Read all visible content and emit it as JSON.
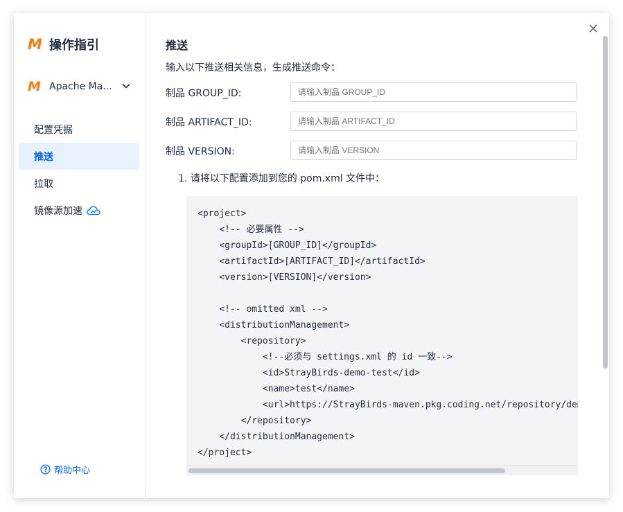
{
  "sidebar": {
    "logo_letter": "M",
    "title": "操作指引",
    "repo": {
      "name": "Apache Ma...",
      "icon": "maven-logo-icon",
      "dropdown_icon": "chevron-down-icon"
    },
    "nav": [
      {
        "label": "配置凭据",
        "active": false
      },
      {
        "label": "推送",
        "active": true
      },
      {
        "label": "拉取",
        "active": false
      },
      {
        "label": "镜像源加速",
        "active": false,
        "icon": "cloud-icon"
      }
    ],
    "help": {
      "label": "帮助中心",
      "icon": "question-circle-icon"
    }
  },
  "main": {
    "title": "推送",
    "description": "输入以下推送相关信息，生成推送命令：",
    "fields": [
      {
        "label": "制品 GROUP_ID:",
        "placeholder": "请输入制品 GROUP_ID",
        "value": ""
      },
      {
        "label": "制品 ARTIFACT_ID:",
        "placeholder": "请输入制品 ARTIFACT_ID",
        "value": ""
      },
      {
        "label": "制品 VERSION:",
        "placeholder": "请输入制品 VERSION",
        "value": ""
      }
    ],
    "step1": "1. 请将以下配置添加到您的 pom.xml 文件中：",
    "code_lines": [
      "<project>",
      "    <!-- 必要属性 -->",
      "    <groupId>[GROUP_ID]</groupId>",
      "    <artifactId>[ARTIFACT_ID]</artifactId>",
      "    <version>[VERSION]</version>",
      "",
      "    <!-- omitted xml -->",
      "    <distributionManagement>",
      "        <repository>",
      "            <!--必须与 settings.xml 的 id 一致-->",
      "            <id>StrayBirds-demo-test</id>",
      "            <name>test</name>",
      "            <url>https://StrayBirds-maven.pkg.coding.net/repository/demo/test/</url>",
      "        </repository>",
      "    </distributionManagement>",
      "</project>"
    ]
  },
  "colors": {
    "accent": "#0066ff",
    "logo": "#f57d0f",
    "active_bg": "#e8f1fe",
    "code_bg": "#f3f4f6"
  }
}
